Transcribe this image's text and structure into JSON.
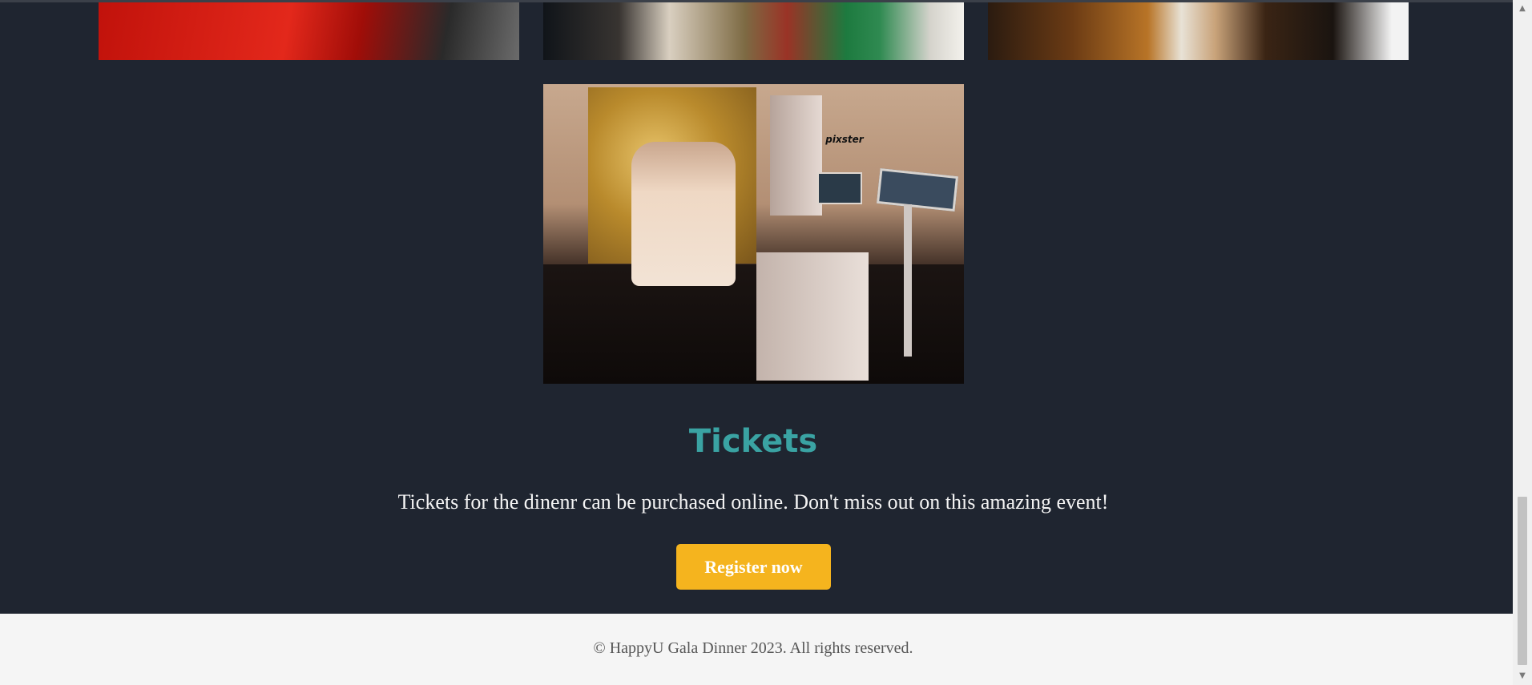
{
  "gallery": {
    "booth_brand": "pixster"
  },
  "tickets": {
    "title": "Tickets",
    "text": "Tickets for the dinenr can be purchased online. Don't miss out on this amazing event!",
    "register_label": "Register now"
  },
  "footer": {
    "text": "© HappyU Gala Dinner 2023. All rights reserved."
  },
  "scrollbar": {
    "up_icon": "▲",
    "down_icon": "▼"
  },
  "colors": {
    "background": "#1f2530",
    "accent_teal": "#3aa3a3",
    "button": "#f5b41e",
    "footer_bg": "#f5f5f5"
  }
}
